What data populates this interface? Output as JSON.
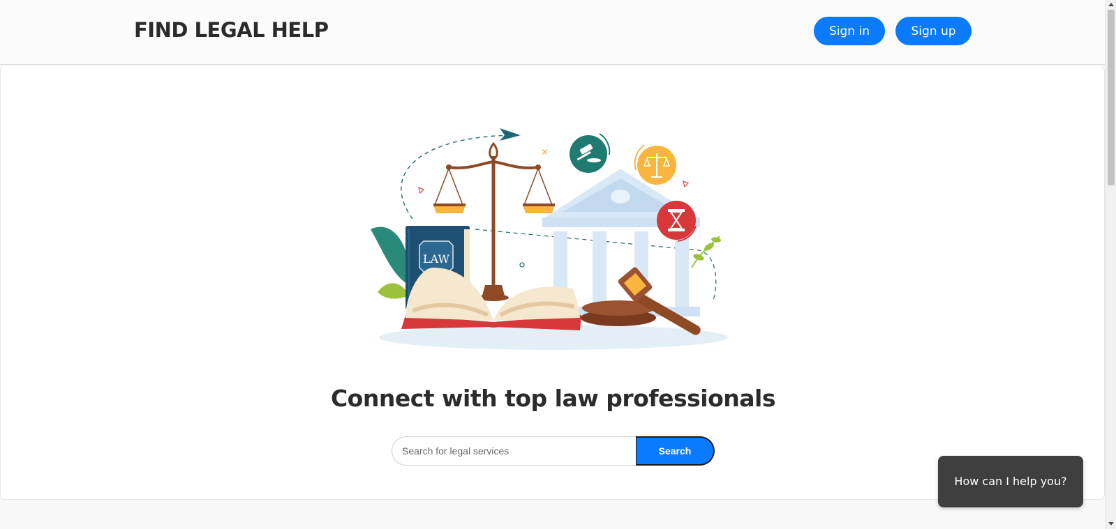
{
  "header": {
    "brand": "FIND LEGAL HELP",
    "signin_label": "Sign in",
    "signup_label": "Sign up"
  },
  "hero": {
    "book_label": "LAW",
    "headline": "Connect with top law professionals"
  },
  "search": {
    "placeholder": "Search for legal services",
    "value": "",
    "button_label": "Search"
  },
  "chat": {
    "label": "How can I help you?"
  },
  "colors": {
    "primary": "#0a7bff",
    "text_dark": "#2b2b2b",
    "chat_bg": "#3f3f3f"
  }
}
